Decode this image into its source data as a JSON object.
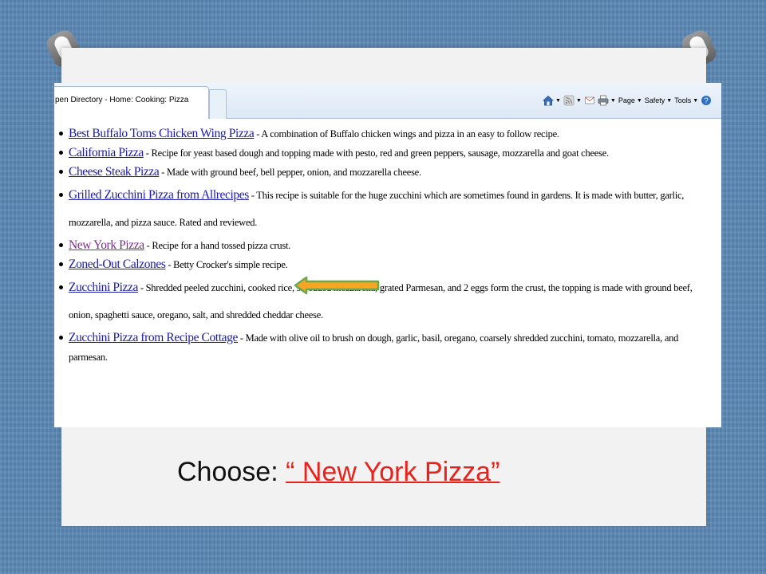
{
  "browser": {
    "tab_title": "pen Directory - Home: Cooking: Pizza",
    "toolbar": {
      "page_label": "Page",
      "safety_label": "Safety",
      "tools_label": "Tools",
      "icons": [
        "home-icon",
        "rss-feed-icon",
        "read-mail-icon",
        "print-icon",
        "help-icon"
      ]
    }
  },
  "results": [
    {
      "link": "Best Buffalo Toms Chicken Wing Pizza",
      "desc": " - A combination of Buffalo chicken wings and pizza in an easy to follow recipe.",
      "visited": false
    },
    {
      "link": "California Pizza",
      "desc": " - Recipe for yeast based dough and topping made with pesto, red and green peppers, sausage, mozzarella and goat cheese.",
      "visited": false
    },
    {
      "link": "Cheese Steak Pizza",
      "desc": " - Made with ground beef, bell pepper, onion, and mozzarella cheese.",
      "visited": false
    },
    {
      "link": "Grilled Zucchini Pizza from Allrecipes",
      "desc": " - This recipe is suitable for the huge zucchini which are sometimes found in gardens. It is made with butter, garlic, mozzarella, and pizza sauce. Rated and reviewed.",
      "visited": false
    },
    {
      "link": "New York Pizza",
      "desc": " - Recipe for a hand tossed pizza crust.",
      "visited": true
    },
    {
      "link": "Zoned-Out Calzones",
      "desc": " - Betty Crocker's simple recipe.",
      "visited": false
    },
    {
      "link": "Zucchini Pizza",
      "desc": " - Shredded peeled zucchini, cooked rice, shredded mozzarella, grated Parmesan, and 2 eggs form the crust, the topping is made with ground beef, onion, spaghetti sauce, oregano, salt, and shredded cheddar cheese.",
      "visited": false
    },
    {
      "link": "Zucchini Pizza from Recipe Cottage",
      "desc": " - Made with olive oil to brush on dough, garlic, basil, oregano, coarsely shredded zucchini, tomato, mozzarella, and parmesan.",
      "visited": false
    }
  ],
  "caption": {
    "prefix": "Choose: ",
    "highlight": "“ New York Pizza”"
  },
  "colors": {
    "background": "#5b87b3",
    "link": "#1a1aa8",
    "visited_link": "#7a2a8a",
    "caption_highlight": "#e8211b",
    "arrow_fill": "#f5a623",
    "arrow_stroke": "#6aa84f"
  }
}
